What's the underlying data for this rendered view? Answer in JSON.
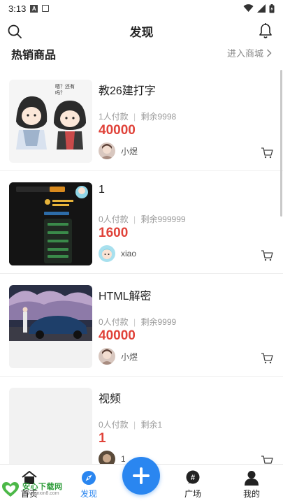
{
  "status_bar": {
    "time": "3:13"
  },
  "header": {
    "title": "发现"
  },
  "section": {
    "title": "热销商品",
    "link": "进入商城"
  },
  "products": [
    {
      "name": "教26建打字",
      "paid": "1人付款",
      "stock": "剩余9998",
      "price": "40000",
      "seller": "小煜",
      "thumb_caption": "嗯？还有吗？"
    },
    {
      "name": "1",
      "paid": "0人付款",
      "stock": "剩余999999",
      "price": "1600",
      "seller": "xiao"
    },
    {
      "name": "HTML解密",
      "paid": "0人付款",
      "stock": "剩余9999",
      "price": "40000",
      "seller": "小煜"
    },
    {
      "name": "视频",
      "paid": "0人付款",
      "stock": "剩余1",
      "price": "1",
      "seller": "1"
    }
  ],
  "separator": "|",
  "nav": {
    "home": "首页",
    "discover": "发现",
    "plaza": "广场",
    "mine": "我的"
  },
  "watermark": {
    "title": "安心下载网",
    "url": "www.anxin8.com"
  },
  "colors": {
    "accent": "#2a86f0",
    "price": "#e0433a"
  },
  "icons": {
    "search": "search-icon",
    "bell": "bell-icon",
    "chevron": "chevron-right-icon",
    "cart": "cart-icon",
    "plus": "plus-icon"
  }
}
